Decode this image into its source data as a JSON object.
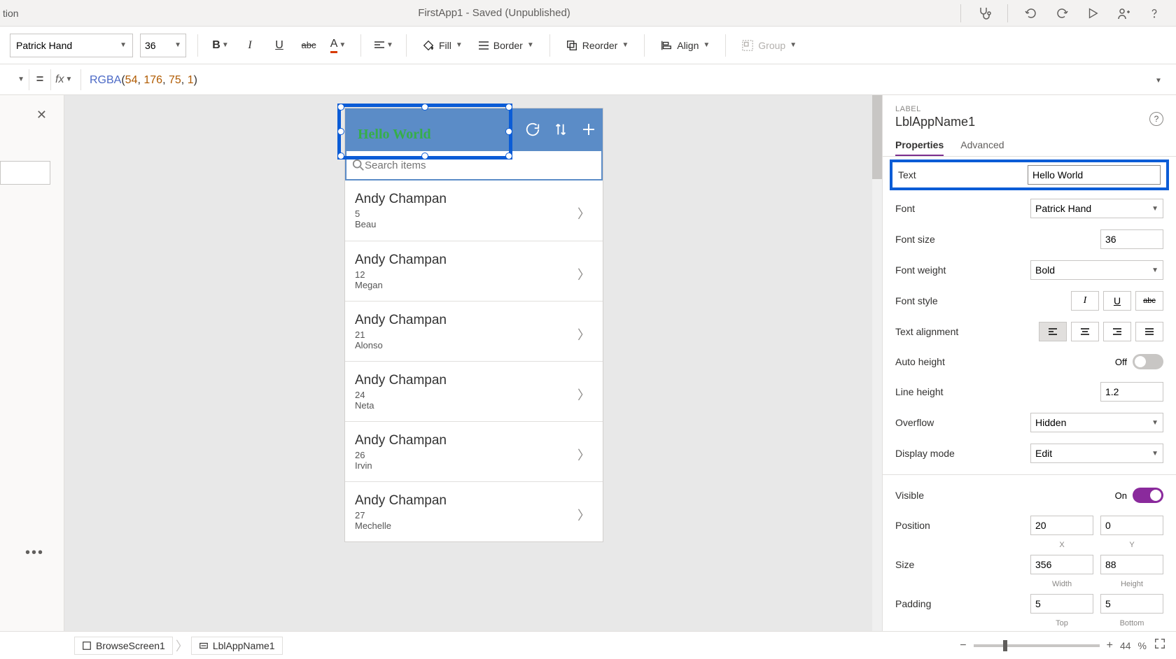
{
  "titlebar": {
    "left_fragment": "tion",
    "app_title": "FirstApp1 - Saved (Unpublished)"
  },
  "ribbon": {
    "font": "Patrick Hand",
    "font_size": "36",
    "fill_label": "Fill",
    "border_label": "Border",
    "reorder_label": "Reorder",
    "align_label": "Align",
    "group_label": "Group"
  },
  "formula": {
    "eq": "=",
    "fx": "fx",
    "text_prefix": "RGBA",
    "args": "(54, 176, 75, 1)"
  },
  "canvas": {
    "label_text": "Hello World",
    "search_placeholder": "Search items",
    "items": [
      {
        "title": "Andy Champan",
        "sub1": "5",
        "sub2": "Beau"
      },
      {
        "title": "Andy Champan",
        "sub1": "12",
        "sub2": "Megan"
      },
      {
        "title": "Andy Champan",
        "sub1": "21",
        "sub2": "Alonso"
      },
      {
        "title": "Andy Champan",
        "sub1": "24",
        "sub2": "Neta"
      },
      {
        "title": "Andy Champan",
        "sub1": "26",
        "sub2": "Irvin"
      },
      {
        "title": "Andy Champan",
        "sub1": "27",
        "sub2": "Mechelle"
      }
    ]
  },
  "props": {
    "type_label": "LABEL",
    "control_name": "LblAppName1",
    "tabs": {
      "properties": "Properties",
      "advanced": "Advanced"
    },
    "rows": {
      "text": {
        "label": "Text",
        "value": "Hello World"
      },
      "font": {
        "label": "Font",
        "value": "Patrick Hand"
      },
      "font_size": {
        "label": "Font size",
        "value": "36"
      },
      "font_weight": {
        "label": "Font weight",
        "value": "Bold"
      },
      "font_style": {
        "label": "Font style"
      },
      "text_align": {
        "label": "Text alignment"
      },
      "auto_height": {
        "label": "Auto height",
        "state": "Off"
      },
      "line_height": {
        "label": "Line height",
        "value": "1.2"
      },
      "overflow": {
        "label": "Overflow",
        "value": "Hidden"
      },
      "display_mode": {
        "label": "Display mode",
        "value": "Edit"
      },
      "visible": {
        "label": "Visible",
        "state": "On"
      },
      "position": {
        "label": "Position",
        "x": "20",
        "y": "0",
        "xl": "X",
        "yl": "Y"
      },
      "size": {
        "label": "Size",
        "w": "356",
        "h": "88",
        "wl": "Width",
        "hl": "Height"
      },
      "padding": {
        "label": "Padding",
        "t": "5",
        "b": "5",
        "tl": "Top",
        "bl": "Bottom"
      }
    }
  },
  "statusbar": {
    "crumb1": "BrowseScreen1",
    "crumb2": "LblAppName1",
    "zoom_pct": "44",
    "zoom_unit": "%"
  }
}
